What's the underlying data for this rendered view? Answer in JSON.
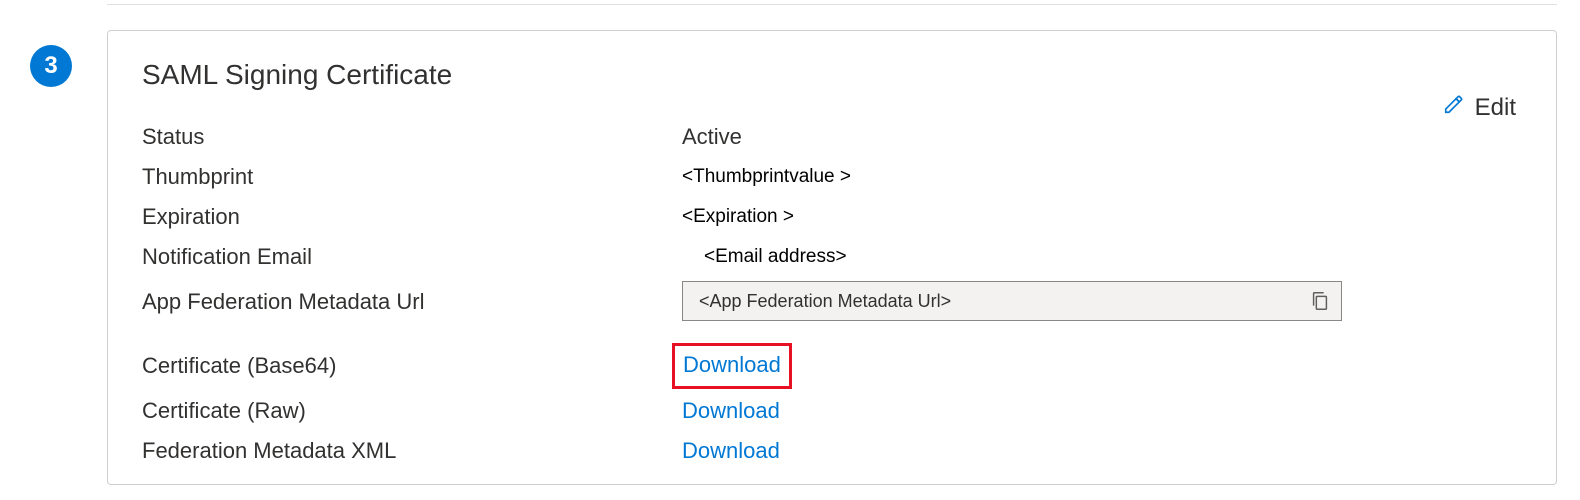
{
  "step": {
    "number": "3"
  },
  "card": {
    "title": "SAML Signing Certificate",
    "edit_label": "Edit"
  },
  "fields": {
    "status": {
      "label": "Status",
      "value": "Active"
    },
    "thumbprint": {
      "label": "Thumbprint",
      "value": "<Thumbprintvalue >"
    },
    "expiration": {
      "label": "Expiration",
      "value": "<Expiration >"
    },
    "notification_email": {
      "label": "Notification Email",
      "value": "<Email address>"
    },
    "app_federation_url": {
      "label": "App Federation Metadata Url",
      "value": "<App Federation Metadata Url>"
    },
    "cert_base64": {
      "label": "Certificate (Base64)",
      "action": "Download"
    },
    "cert_raw": {
      "label": "Certificate (Raw)",
      "action": "Download"
    },
    "fed_metadata_xml": {
      "label": "Federation Metadata XML",
      "action": "Download"
    }
  }
}
